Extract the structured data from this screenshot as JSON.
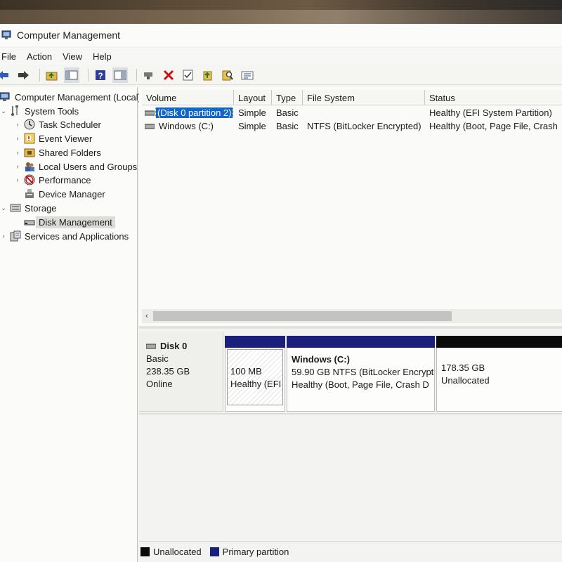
{
  "window": {
    "title": "Computer Management"
  },
  "menu": [
    "File",
    "Action",
    "View",
    "Help"
  ],
  "toolbar": {
    "icons": [
      "back-arrow-icon",
      "forward-arrow-icon",
      "up-folder-icon",
      "show-hide-tree-icon",
      "help-icon",
      "console-view-icon",
      "connect-icon",
      "delete-icon",
      "check-icon",
      "export-icon",
      "search-icon",
      "properties-icon"
    ]
  },
  "tree": {
    "root": "Computer Management (Local)",
    "system_tools": "System Tools",
    "task_scheduler": "Task Scheduler",
    "event_viewer": "Event Viewer",
    "shared_folders": "Shared Folders",
    "local_users": "Local Users and Groups",
    "performance": "Performance",
    "device_manager": "Device Manager",
    "storage": "Storage",
    "disk_management": "Disk Management",
    "services": "Services and Applications"
  },
  "volume_table": {
    "headers": [
      "Volume",
      "Layout",
      "Type",
      "File System",
      "Status"
    ],
    "rows": [
      [
        "(Disk 0 partition 2)",
        "Simple",
        "Basic",
        "",
        "Healthy (EFI System Partition)"
      ],
      [
        "Windows (C:)",
        "Simple",
        "Basic",
        "NTFS (BitLocker Encrypted)",
        "Healthy (Boot, Page File, Crash"
      ]
    ]
  },
  "disk": {
    "name": "Disk 0",
    "type": "Basic",
    "size": "238.35 GB",
    "state": "Online",
    "partitions": {
      "efi": {
        "size": "100 MB",
        "status": "Healthy (EFI"
      },
      "windows": {
        "name": "Windows  (C:)",
        "detail": "59.90 GB NTFS (BitLocker Encrypt",
        "status": "Healthy (Boot, Page File, Crash D"
      },
      "unallocated": {
        "size": "178.35 GB",
        "label": "Unallocated"
      }
    }
  },
  "legend": {
    "unallocated": "Unallocated",
    "primary": "Primary partition"
  },
  "colors": {
    "primary": "#1a1f7a",
    "unallocated": "#0a0a0a",
    "selection": "#1166cc"
  }
}
